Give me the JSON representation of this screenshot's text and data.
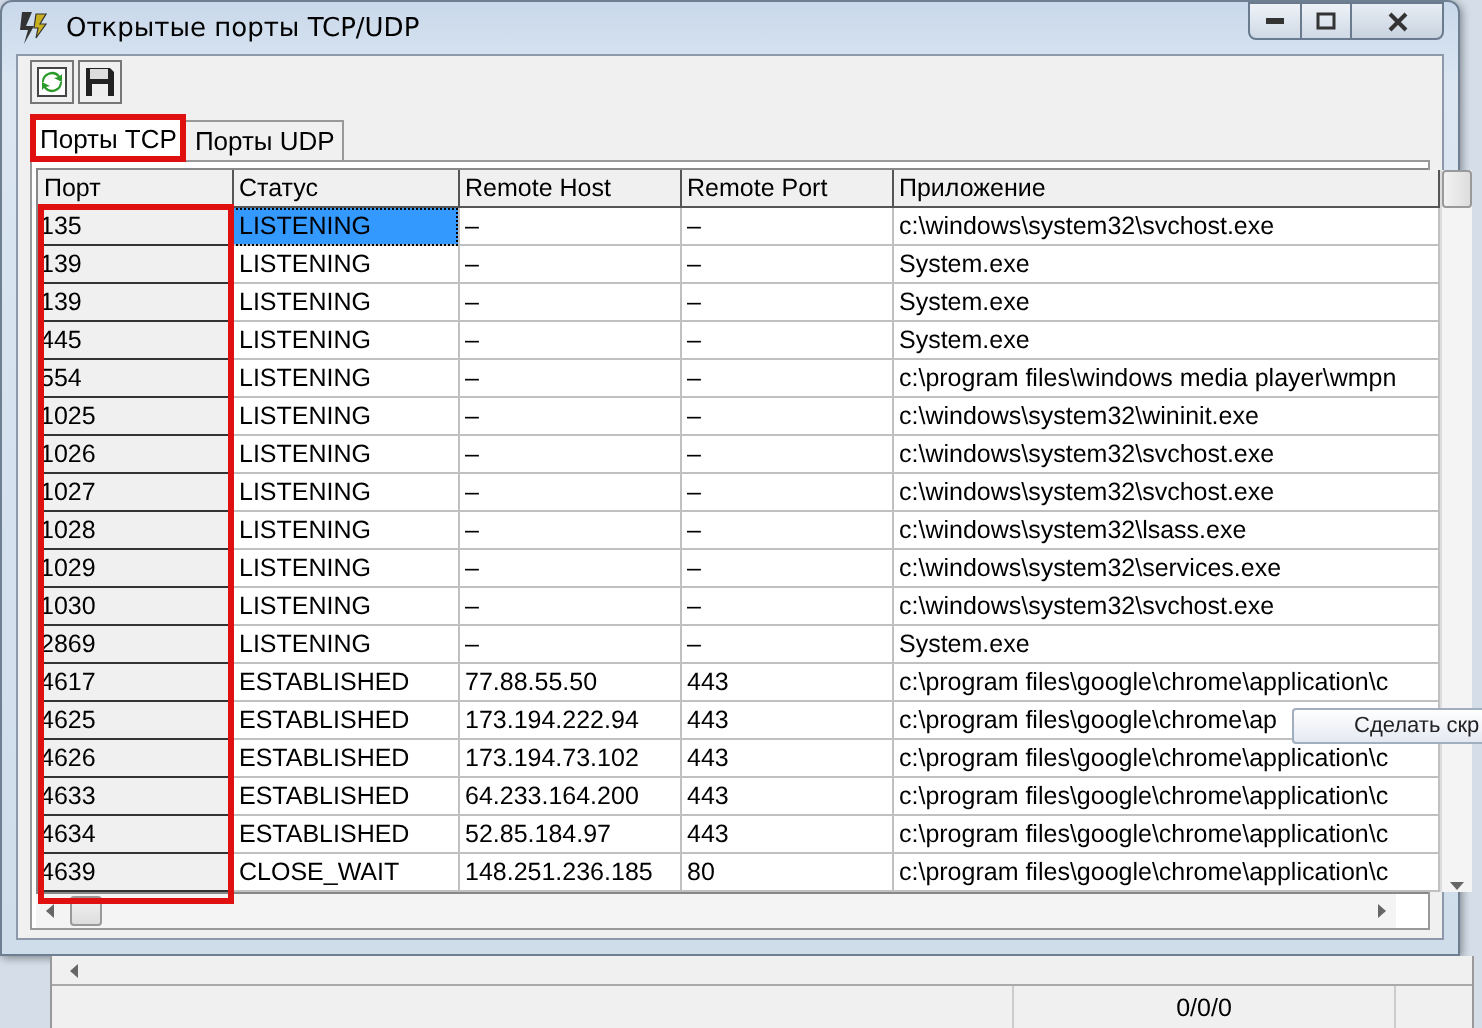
{
  "window": {
    "title": "Открытые порты TCP/UDP"
  },
  "toolbar": [
    {
      "kind": "refresh"
    },
    {
      "kind": "save"
    }
  ],
  "tabs": [
    {
      "label": "Порты TCP",
      "selected": true,
      "highlighted": true
    },
    {
      "label": "Порты UDP",
      "selected": false,
      "highlighted": false
    }
  ],
  "table": {
    "columns": [
      {
        "label": "Порт",
        "highlighted": true
      },
      {
        "label": "Статус",
        "highlighted": false
      },
      {
        "label": "Remote Host",
        "highlighted": false
      },
      {
        "label": "Remote Port",
        "highlighted": false
      },
      {
        "label": "Приложение",
        "highlighted": false
      }
    ],
    "rows": [
      {
        "cells": [
          "135",
          "LISTENING",
          "–",
          "–",
          "c:\\windows\\system32\\svchost.exe"
        ],
        "selected": true
      },
      {
        "cells": [
          "139",
          "LISTENING",
          "–",
          "–",
          "System.exe"
        ],
        "selected": false
      },
      {
        "cells": [
          "139",
          "LISTENING",
          "–",
          "–",
          "System.exe"
        ],
        "selected": false
      },
      {
        "cells": [
          "445",
          "LISTENING",
          "–",
          "–",
          "System.exe"
        ],
        "selected": false
      },
      {
        "cells": [
          "554",
          "LISTENING",
          "–",
          "–",
          "c:\\program files\\windows media player\\wmpn"
        ],
        "selected": false
      },
      {
        "cells": [
          "1025",
          "LISTENING",
          "–",
          "–",
          "c:\\windows\\system32\\wininit.exe"
        ],
        "selected": false
      },
      {
        "cells": [
          "1026",
          "LISTENING",
          "–",
          "–",
          "c:\\windows\\system32\\svchost.exe"
        ],
        "selected": false
      },
      {
        "cells": [
          "1027",
          "LISTENING",
          "–",
          "–",
          "c:\\windows\\system32\\svchost.exe"
        ],
        "selected": false
      },
      {
        "cells": [
          "1028",
          "LISTENING",
          "–",
          "–",
          "c:\\windows\\system32\\lsass.exe"
        ],
        "selected": false
      },
      {
        "cells": [
          "1029",
          "LISTENING",
          "–",
          "–",
          "c:\\windows\\system32\\services.exe"
        ],
        "selected": false
      },
      {
        "cells": [
          "1030",
          "LISTENING",
          "–",
          "–",
          "c:\\windows\\system32\\svchost.exe"
        ],
        "selected": false
      },
      {
        "cells": [
          "2869",
          "LISTENING",
          "–",
          "–",
          "System.exe"
        ],
        "selected": false
      },
      {
        "cells": [
          "4617",
          "ESTABLISHED",
          "77.88.55.50",
          "443",
          "c:\\program files\\google\\chrome\\application\\c"
        ],
        "selected": false
      },
      {
        "cells": [
          "4625",
          "ESTABLISHED",
          "173.194.222.94",
          "443",
          "c:\\program files\\google\\chrome\\ap"
        ],
        "selected": false
      },
      {
        "cells": [
          "4626",
          "ESTABLISHED",
          "173.194.73.102",
          "443",
          "c:\\program files\\google\\chrome\\application\\c"
        ],
        "selected": false
      },
      {
        "cells": [
          "4633",
          "ESTABLISHED",
          "64.233.164.200",
          "443",
          "c:\\program files\\google\\chrome\\application\\c"
        ],
        "selected": false
      },
      {
        "cells": [
          "4634",
          "ESTABLISHED",
          "52.85.184.97",
          "443",
          "c:\\program files\\google\\chrome\\application\\c"
        ],
        "selected": false
      },
      {
        "cells": [
          "4639",
          "CLOSE_WAIT",
          "148.251.236.185",
          "80",
          "c:\\program files\\google\\chrome\\application\\c"
        ],
        "selected": false
      }
    ]
  },
  "tooltip": {
    "text": "Сделать скр"
  },
  "status_bar": {
    "text": "0/0/0"
  }
}
